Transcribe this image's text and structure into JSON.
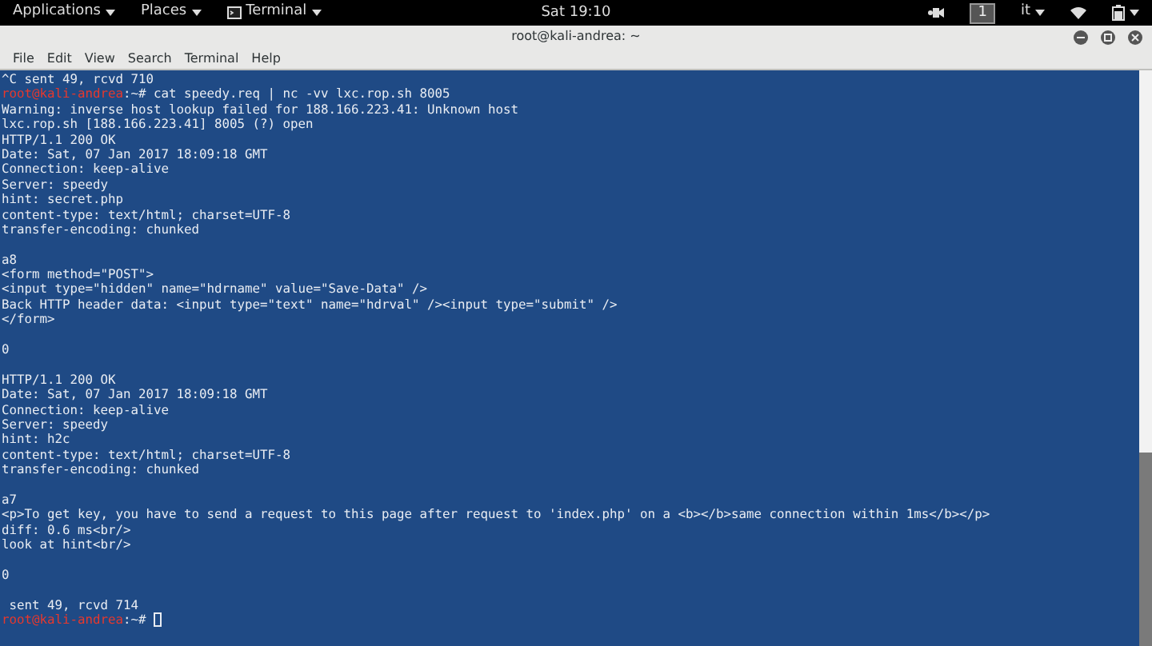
{
  "top_bar": {
    "menus": [
      {
        "label": "Applications",
        "kind": "menu"
      },
      {
        "label": "Places",
        "kind": "menu"
      },
      {
        "label": "Terminal",
        "kind": "app"
      }
    ],
    "clock": "Sat 19:10",
    "workspace": "1",
    "language": "it"
  },
  "window": {
    "title": "root@kali-andrea: ~"
  },
  "menu_bar": [
    "File",
    "Edit",
    "View",
    "Search",
    "Terminal",
    "Help"
  ],
  "terminal": {
    "lines": [
      {
        "kind": "output",
        "text": "^C sent 49, rcvd 710"
      },
      {
        "kind": "prompt",
        "user": "root@kali-andrea",
        "path": ":~# ",
        "command": "cat speedy.req | nc -vv lxc.rop.sh 8005"
      },
      {
        "kind": "output",
        "text": "Warning: inverse host lookup failed for 188.166.223.41: Unknown host"
      },
      {
        "kind": "output",
        "text": "lxc.rop.sh [188.166.223.41] 8005 (?) open"
      },
      {
        "kind": "output",
        "text": "HTTP/1.1 200 OK"
      },
      {
        "kind": "output",
        "text": "Date: Sat, 07 Jan 2017 18:09:18 GMT"
      },
      {
        "kind": "output",
        "text": "Connection: keep-alive"
      },
      {
        "kind": "output",
        "text": "Server: speedy"
      },
      {
        "kind": "output",
        "text": "hint: secret.php"
      },
      {
        "kind": "output",
        "text": "content-type: text/html; charset=UTF-8"
      },
      {
        "kind": "output",
        "text": "transfer-encoding: chunked"
      },
      {
        "kind": "blank"
      },
      {
        "kind": "output",
        "text": "a8"
      },
      {
        "kind": "output",
        "text": "<form method=\"POST\">"
      },
      {
        "kind": "output",
        "text": "<input type=\"hidden\" name=\"hdrname\" value=\"Save-Data\" />"
      },
      {
        "kind": "output",
        "text": "Back HTTP header data: <input type=\"text\" name=\"hdrval\" /><input type=\"submit\" />"
      },
      {
        "kind": "output",
        "text": "</form>"
      },
      {
        "kind": "blank"
      },
      {
        "kind": "output",
        "text": "0"
      },
      {
        "kind": "blank"
      },
      {
        "kind": "output",
        "text": "HTTP/1.1 200 OK"
      },
      {
        "kind": "output",
        "text": "Date: Sat, 07 Jan 2017 18:09:18 GMT"
      },
      {
        "kind": "output",
        "text": "Connection: keep-alive"
      },
      {
        "kind": "output",
        "text": "Server: speedy"
      },
      {
        "kind": "output",
        "text": "hint: h2c"
      },
      {
        "kind": "output",
        "text": "content-type: text/html; charset=UTF-8"
      },
      {
        "kind": "output",
        "text": "transfer-encoding: chunked"
      },
      {
        "kind": "blank"
      },
      {
        "kind": "output",
        "text": "a7"
      },
      {
        "kind": "output",
        "text": "<p>To get key, you have to send a request to this page after request to 'index.php' on a <b></b>same connection within 1ms</b></p>"
      },
      {
        "kind": "output",
        "text": "diff: 0.6 ms<br/>"
      },
      {
        "kind": "output",
        "text": "look at hint<br/>"
      },
      {
        "kind": "blank"
      },
      {
        "kind": "output",
        "text": "0"
      },
      {
        "kind": "blank"
      },
      {
        "kind": "output",
        "text": " sent 49, rcvd 714"
      },
      {
        "kind": "prompt",
        "user": "root@kali-andrea",
        "path": ":~# ",
        "cursor": true
      }
    ]
  }
}
